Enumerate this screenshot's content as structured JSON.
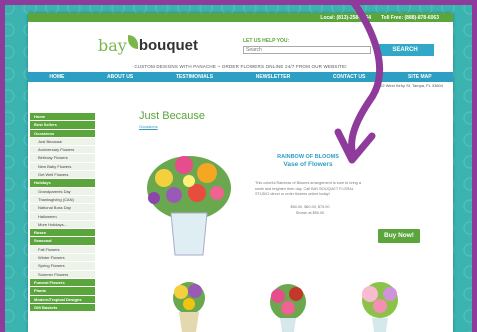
{
  "topbar": {
    "local": "Local: (813)-258-2664",
    "toll": "Toll Free: (888)-878-6063"
  },
  "logo": {
    "bay": "bay",
    "bouquet": "bouquet"
  },
  "search": {
    "help_label": "LET US HELP YOU:",
    "placeholder": "Search",
    "button": "SEARCH"
  },
  "tagline": "CUSTOM DESIGNS WITH PANACHE ~ ORDER FLOWERS ONLINE 24/7 FROM OUR WEBSITE!",
  "nav": [
    "HOME",
    "ABOUT US",
    "TESTIMONIALS",
    "NEWSLETTER",
    "CONTACT US",
    "SITE MAP"
  ],
  "address": "102 West Kirby St, Tampa, FL 33604",
  "sidebar": [
    {
      "label": "Home",
      "type": "cat"
    },
    {
      "label": "Best Sellers",
      "type": "cat"
    },
    {
      "label": "Occasions",
      "type": "cat"
    },
    {
      "label": "Just Because",
      "type": "sub"
    },
    {
      "label": "Anniversary Flowers",
      "type": "sub"
    },
    {
      "label": "Birthday Flowers",
      "type": "sub"
    },
    {
      "label": "New Baby Flowers",
      "type": "sub"
    },
    {
      "label": "Get Well Flowers",
      "type": "sub"
    },
    {
      "label": "Holidays",
      "type": "cat"
    },
    {
      "label": "Grandparents Day",
      "type": "sub"
    },
    {
      "label": "Thanksgiving (CAN)",
      "type": "sub"
    },
    {
      "label": "National Boss Day",
      "type": "sub"
    },
    {
      "label": "Halloween",
      "type": "sub"
    },
    {
      "label": "More Holidays...",
      "type": "sub"
    },
    {
      "label": "Roses",
      "type": "cat"
    },
    {
      "label": "Seasonal",
      "type": "cat"
    },
    {
      "label": "Fall Flowers",
      "type": "sub"
    },
    {
      "label": "Winter Flowers",
      "type": "sub"
    },
    {
      "label": "Spring Flowers",
      "type": "sub"
    },
    {
      "label": "Summer Flowers",
      "type": "sub"
    },
    {
      "label": "Funeral Flowers",
      "type": "cat"
    },
    {
      "label": "Plants",
      "type": "cat"
    },
    {
      "label": "Modern/Tropical Designs",
      "type": "cat"
    },
    {
      "label": "Gift Baskets",
      "type": "cat"
    }
  ],
  "page_title": "Just Because",
  "breadcrumb": "Occasions",
  "product": {
    "name_line1": "RAINBOW OF BLOOMS",
    "name_line2": "Vase of Flowers",
    "description": "This colorful Rainbow of Blooms arrangement is sure to bring a smile and brighten their day. Call BAY BOUQUET FLORAL STUDIO direct or order flowers online today!",
    "prices": "$50.00, $60.00, $75.00",
    "shown": "Shown at $50.00",
    "buy": "Buy Now!"
  },
  "colors": {
    "frame": "#8e3b9b",
    "green": "#5aa53c",
    "blue": "#2d9fc2",
    "teal_bg": "#3bb3b1"
  }
}
